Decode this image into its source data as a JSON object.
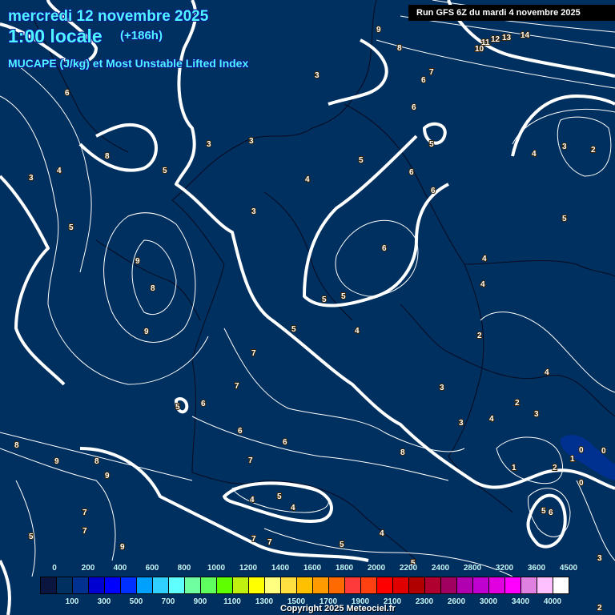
{
  "header": {
    "date": "mercredi 12 novembre 2025",
    "hour": "1:00 locale",
    "lead": "(+186h)",
    "parameter": "MUCAPE (J/kg) et Most Unstable Lifted Index",
    "run": "Run GFS 6Z du mardi 4 novembre 2025"
  },
  "colors": {
    "background": "#00305f",
    "title": "#4ef6ff",
    "contour": "#ffffff"
  },
  "legend": {
    "swatches": [
      "#0a1540",
      "#003060",
      "#003090",
      "#0000d0",
      "#0000ff",
      "#0030ff",
      "#00a0ff",
      "#30d0ff",
      "#60ffff",
      "#70ffa0",
      "#60ff60",
      "#60ff00",
      "#c0f010",
      "#ffff00",
      "#ffff80",
      "#ffe040",
      "#ffc000",
      "#ff9a00",
      "#ff6a00",
      "#ff3a3a",
      "#ff4010",
      "#ff0000",
      "#e00000",
      "#b00000",
      "#b00030",
      "#a00060",
      "#b000b0",
      "#c000d0",
      "#e000e0",
      "#ff00ff",
      "#e080e0",
      "#ffc0ff",
      "#ffffff"
    ],
    "top_labels": [
      "0",
      "200",
      "400",
      "600",
      "800",
      "1000",
      "1200",
      "1400",
      "1600",
      "1800",
      "2000",
      "2200",
      "2400",
      "2800",
      "3200",
      "3600",
      "4500"
    ],
    "bottom_labels": [
      "100",
      "300",
      "500",
      "700",
      "900",
      "1100",
      "1300",
      "1500",
      "1700",
      "1900",
      "2100",
      "2300",
      "2600",
      "3000",
      "3400",
      "4000"
    ]
  },
  "contour_labels": [
    "9",
    "8",
    "7",
    "6",
    "6",
    "5",
    "3",
    "6",
    "8",
    "3",
    "4",
    "5",
    "3",
    "3",
    "4",
    "3",
    "5",
    "6",
    "6",
    "4",
    "3",
    "2",
    "5",
    "5",
    "9",
    "8",
    "9",
    "6",
    "4",
    "4",
    "5",
    "5",
    "5",
    "4",
    "2",
    "4",
    "7",
    "7",
    "3",
    "2",
    "3",
    "3",
    "4",
    "5",
    "6",
    "6",
    "6",
    "8",
    "9",
    "8",
    "9",
    "7",
    "8",
    "0",
    "1",
    "0",
    "1",
    "2",
    "0",
    "4",
    "5",
    "4",
    "7",
    "7",
    "5",
    "6",
    "5",
    "9",
    "7",
    "7",
    "4",
    "5",
    "3",
    "2",
    "5",
    "10",
    "11",
    "12",
    "13",
    "14"
  ],
  "copyright": "Copyright 2025 Meteociel.fr"
}
